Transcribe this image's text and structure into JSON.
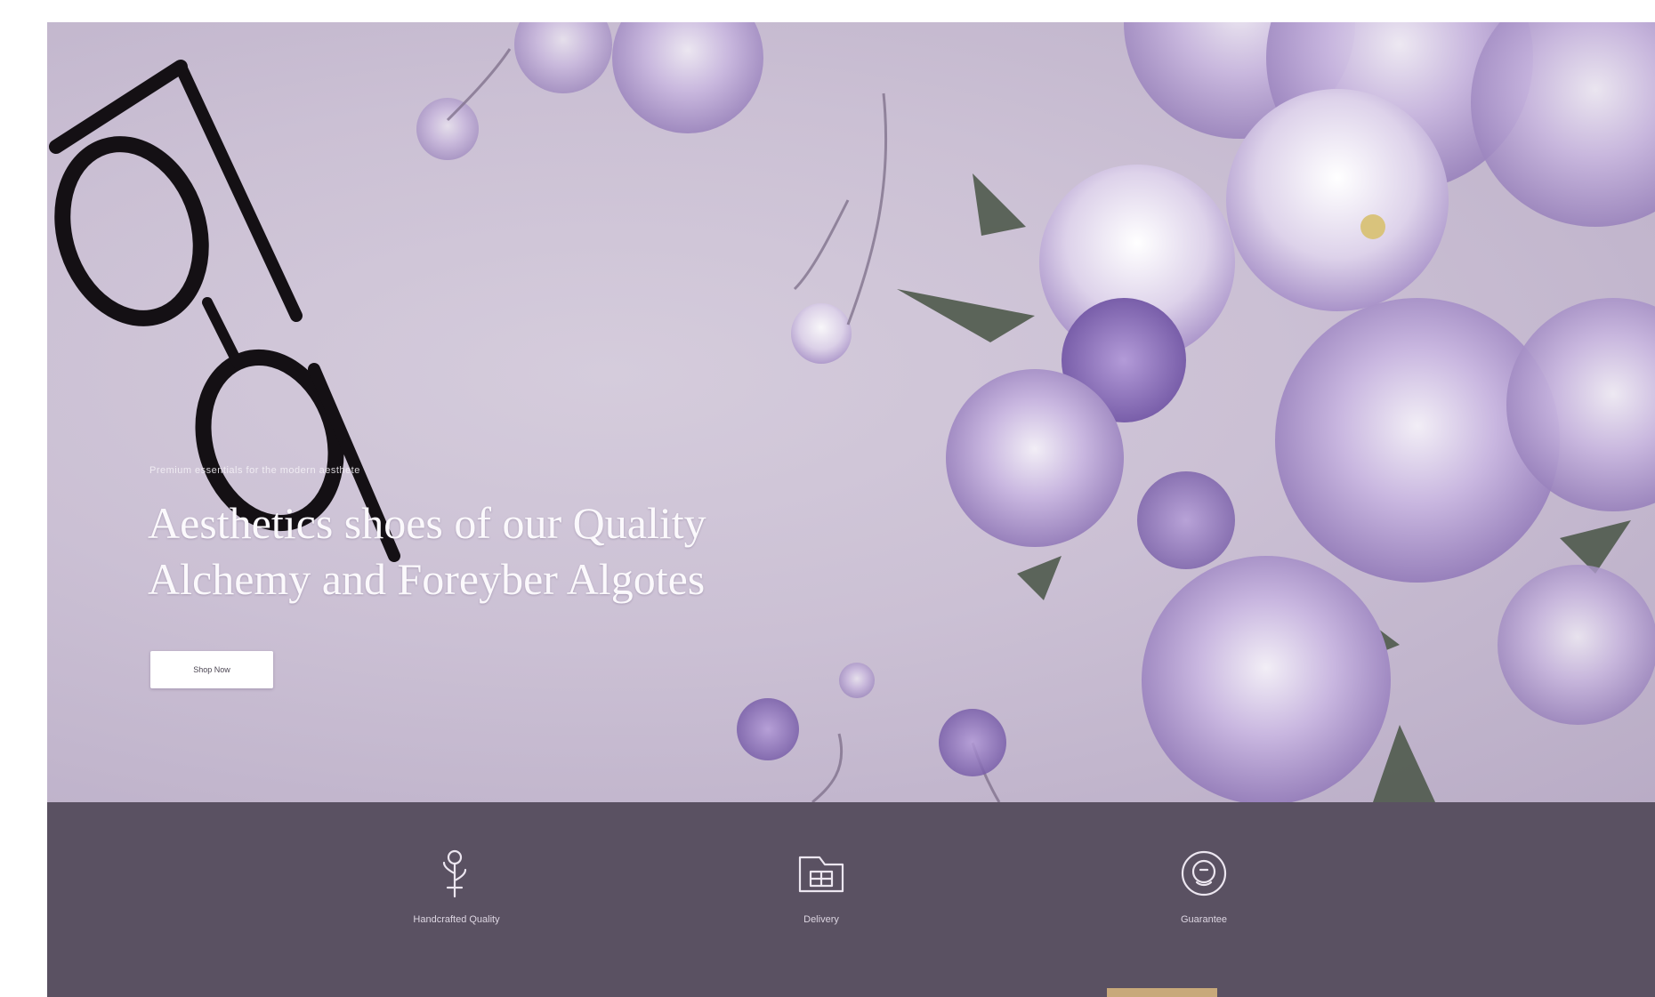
{
  "hero": {
    "eyebrow": "Premium essentials for the modern aesthete",
    "headline_line1": "Aesthetics shoes of our Quality",
    "headline_line2": "Alchemy and Foreyber Algotes",
    "cta_label": "Shop Now"
  },
  "features": [
    {
      "icon": "flower-icon",
      "label": "Handcrafted Quality"
    },
    {
      "icon": "gift-box-icon",
      "label": "Delivery"
    },
    {
      "icon": "support-icon",
      "label": "Guarantee"
    }
  ],
  "colors": {
    "hero_background": "#cbc0d4",
    "feature_band": "#5a5162",
    "accent": "#c8a97a",
    "button": "#ffffff"
  }
}
